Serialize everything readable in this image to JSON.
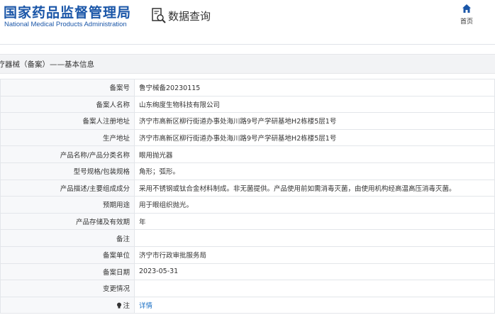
{
  "header": {
    "logo_cn": "国家药品监督管理局",
    "logo_en": "National Medical Products Administration",
    "query_label": "数据查询",
    "home_label": "首页"
  },
  "section_title": "医疗器械（备案）——基本信息",
  "rows": [
    {
      "label": "备案号",
      "value": "鲁宁械备20230115"
    },
    {
      "label": "备案人名称",
      "value": "山东绚度生物科技有限公司"
    },
    {
      "label": "备案人注册地址",
      "value": "济宁市高新区柳行街道办事处海川路9号产学研基地H2栋楼5层1号"
    },
    {
      "label": "生产地址",
      "value": "济宁市高新区柳行街道办事处海川路9号产学研基地H2栋楼5层1号"
    },
    {
      "label": "产品名称/产品分类名称",
      "value": "眼用抛光器"
    },
    {
      "label": "型号规格/包装规格",
      "value": "角形；弧形。"
    },
    {
      "label": "产品描述/主要组成成分",
      "value": "采用不锈钢或钛合金材料制成。非无菌提供。产品使用前如需消毒灭菌，由使用机构经高温高压消毒灭菌。"
    },
    {
      "label": "预期用途",
      "value": "用于眼组织抛光。"
    },
    {
      "label": "产品存储及有效期",
      "value": "年"
    },
    {
      "label": "备注",
      "value": ""
    },
    {
      "label": "备案单位",
      "value": "济宁市行政审批服务局"
    },
    {
      "label": "备案日期",
      "value": "2023-05-31"
    },
    {
      "label": "变更情况",
      "value": ""
    },
    {
      "label": "注",
      "value": "详情"
    }
  ],
  "icons": {
    "query": "magnifier-document-icon",
    "home": "home-icon",
    "note": "info-bulb-icon"
  },
  "colors": {
    "brand_blue": "#1a56a8",
    "link_blue": "#1a6fc4"
  }
}
